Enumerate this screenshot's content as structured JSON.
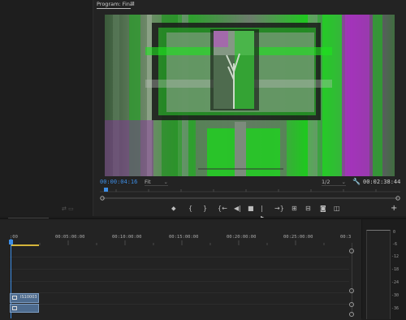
{
  "program_monitor": {
    "title": "Program: Final",
    "menu_icon": "≡",
    "current_timecode": "00:00:04:16",
    "zoom_select": "Fit",
    "resolution_select": "1/2",
    "duration_timecode": "00:02:38:44",
    "controls": [
      {
        "name": "add-marker-icon",
        "glyph": "⬥"
      },
      {
        "name": "mark-in-icon",
        "glyph": "{"
      },
      {
        "name": "mark-out-icon",
        "glyph": "}"
      },
      {
        "name": "go-to-in-icon",
        "glyph": "{←"
      },
      {
        "name": "step-back-icon",
        "glyph": "◀|"
      },
      {
        "name": "stop-icon",
        "glyph": "■"
      },
      {
        "name": "step-forward-icon",
        "glyph": "|▶"
      },
      {
        "name": "go-to-out-icon",
        "glyph": "→}"
      },
      {
        "name": "lift-icon",
        "glyph": "⊞"
      },
      {
        "name": "extract-icon",
        "glyph": "⊟"
      },
      {
        "name": "export-frame-icon",
        "glyph": "◙"
      },
      {
        "name": "comparison-view-icon",
        "glyph": "◫"
      }
    ],
    "add_button": "+"
  },
  "timeline": {
    "ruler": [
      ":00",
      "00:05:00:00",
      "00:10:00:00",
      "00:15:00:00",
      "00:20:00:00",
      "00:25:00:00",
      "00:3"
    ],
    "clip_label": "IS10003"
  },
  "audio_meter": {
    "ticks": [
      "0",
      "-6",
      "-12",
      "-18",
      "-24",
      "-30",
      "-36"
    ]
  },
  "colors": {
    "accent": "#3d8ee6",
    "clip": "#4d6b8e",
    "in_out": "#d4b43a"
  }
}
